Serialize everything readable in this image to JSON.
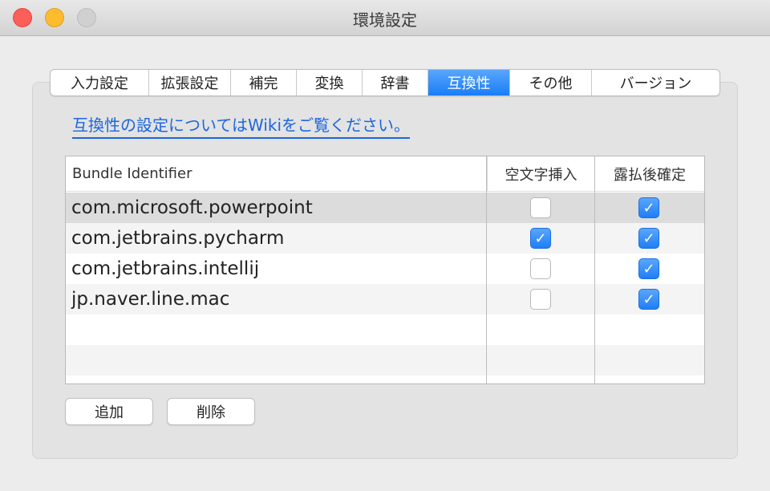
{
  "window": {
    "title": "環境設定"
  },
  "tabs": [
    {
      "label": "入力設定",
      "active": false
    },
    {
      "label": "拡張設定",
      "active": false
    },
    {
      "label": "補完",
      "active": false
    },
    {
      "label": "変換",
      "active": false
    },
    {
      "label": "辞書",
      "active": false
    },
    {
      "label": "互換性",
      "active": true
    },
    {
      "label": "その他",
      "active": false
    },
    {
      "label": "バージョン",
      "active": false
    }
  ],
  "link": {
    "text": "互換性の設定についてはWikiをご覧ください。"
  },
  "table": {
    "headers": {
      "bundle": "Bundle Identifier",
      "empty_char": "空文字挿入",
      "expose_confirm": "露払後確定"
    },
    "rows": [
      {
        "bundle": "com.microsoft.powerpoint",
        "empty_char": false,
        "expose_confirm": true
      },
      {
        "bundle": "com.jetbrains.pycharm",
        "empty_char": true,
        "expose_confirm": true
      },
      {
        "bundle": "com.jetbrains.intellij",
        "empty_char": false,
        "expose_confirm": true
      },
      {
        "bundle": "jp.naver.line.mac",
        "empty_char": false,
        "expose_confirm": true
      }
    ]
  },
  "buttons": {
    "add": "追加",
    "delete": "削除"
  },
  "colors": {
    "accent": "#1a7df6",
    "link": "#1c66e0"
  }
}
